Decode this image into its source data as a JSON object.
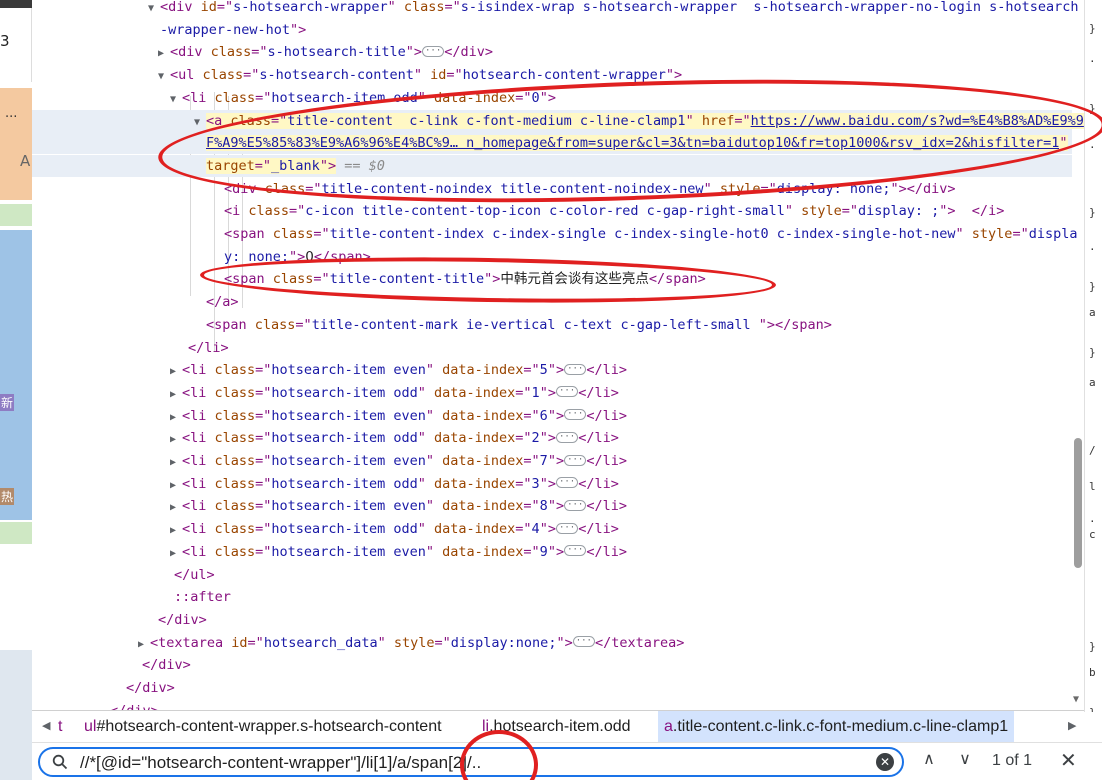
{
  "tree": {
    "rows": [
      {
        "tri": "▼",
        "parts": [
          [
            "tag",
            "<div "
          ],
          [
            "an",
            "id"
          ],
          [
            "tag",
            "=\""
          ],
          [
            "av",
            "s-hotsearch-wrapper"
          ],
          [
            "tag",
            "\" "
          ],
          [
            "an",
            "class"
          ],
          [
            "tag",
            "=\""
          ],
          [
            "av",
            "s-isindex-wrap s-hotsearch-wrapper  s-hotsearch-wrapper-no-login s-hotsearch"
          ]
        ]
      },
      {
        "tri": "",
        "parts": [
          [
            "av",
            "-wrapper-new-hot"
          ],
          [
            "tag",
            "\">"
          ]
        ]
      },
      {
        "tri": "▶",
        "parts": [
          [
            "tag",
            "<div "
          ],
          [
            "an",
            "class"
          ],
          [
            "tag",
            "=\""
          ],
          [
            "av",
            "s-hotsearch-title"
          ],
          [
            "tag",
            "\">"
          ],
          [
            "ell",
            "···"
          ],
          [
            "tag",
            "</div>"
          ]
        ]
      },
      {
        "tri": "▼",
        "parts": [
          [
            "tag",
            "<ul "
          ],
          [
            "an",
            "class"
          ],
          [
            "tag",
            "=\""
          ],
          [
            "av",
            "s-hotsearch-content"
          ],
          [
            "tag",
            "\" "
          ],
          [
            "an",
            "id"
          ],
          [
            "tag",
            "=\""
          ],
          [
            "av",
            "hotsearch-content-wrapper"
          ],
          [
            "tag",
            "\">"
          ]
        ]
      },
      {
        "tri": "▼",
        "parts": [
          [
            "tag",
            "<li "
          ],
          [
            "an",
            "class"
          ],
          [
            "tag",
            "=\""
          ],
          [
            "av",
            "hotsearch-item odd"
          ],
          [
            "tag",
            "\" "
          ],
          [
            "an",
            "data-index"
          ],
          [
            "tag",
            "=\""
          ],
          [
            "av",
            "0"
          ],
          [
            "tag",
            "\">"
          ]
        ]
      },
      {
        "tri": "▼",
        "parts": [
          [
            "tag",
            "<a "
          ],
          [
            "an",
            "class"
          ],
          [
            "tag",
            "=\""
          ],
          [
            "av",
            "title-content  c-link c-font-medium c-line-clamp1"
          ],
          [
            "tag",
            "\" "
          ],
          [
            "an",
            "href"
          ],
          [
            "tag",
            "=\""
          ],
          [
            "avl",
            "https://www.baidu.com/s?wd=%E4%B8%AD%E9%9"
          ]
        ]
      },
      {
        "tri": "",
        "parts": [
          [
            "avl",
            "F%A9%E5%85%83%E9%A6%96%E4%BC%9… n_homepage&from=super&cl=3&tn=baidutop10&fr=top1000&rsv_idx=2&hisfilter=1"
          ],
          [
            "tag",
            "\""
          ]
        ]
      },
      {
        "tri": "",
        "parts": [
          [
            "an",
            "target"
          ],
          [
            "tag",
            "=\""
          ],
          [
            "av",
            "_blank"
          ],
          [
            "tag",
            "\">"
          ],
          [
            "eq",
            " == $0"
          ]
        ]
      },
      {
        "tri": "",
        "parts": [
          [
            "tag",
            "<div "
          ],
          [
            "an",
            "class"
          ],
          [
            "tag",
            "=\""
          ],
          [
            "av",
            "title-content-noindex title-content-noindex-new"
          ],
          [
            "tag",
            "\" "
          ],
          [
            "an",
            "style"
          ],
          [
            "tag",
            "=\""
          ],
          [
            "av",
            "display: none;"
          ],
          [
            "tag",
            "\"></div>"
          ]
        ]
      },
      {
        "tri": "",
        "parts": [
          [
            "tag",
            "<i "
          ],
          [
            "an",
            "class"
          ],
          [
            "tag",
            "=\""
          ],
          [
            "av",
            "c-icon title-content-top-icon c-color-red c-gap-right-small"
          ],
          [
            "tag",
            "\" "
          ],
          [
            "an",
            "style"
          ],
          [
            "tag",
            "=\""
          ],
          [
            "av",
            "display: ;"
          ],
          [
            "tag",
            "\">  </i>"
          ]
        ]
      },
      {
        "tri": "",
        "parts": [
          [
            "tag",
            "<span "
          ],
          [
            "an",
            "class"
          ],
          [
            "tag",
            "=\""
          ],
          [
            "av",
            "title-content-index c-index-single c-index-single-hot0 c-index-single-hot-new"
          ],
          [
            "tag",
            "\" "
          ],
          [
            "an",
            "style"
          ],
          [
            "tag",
            "=\""
          ],
          [
            "av",
            "displa"
          ]
        ]
      },
      {
        "tri": "",
        "parts": [
          [
            "av",
            "y: none;"
          ],
          [
            "tag",
            "\">"
          ],
          [
            "txt",
            "0"
          ],
          [
            "tag",
            "</span>"
          ]
        ]
      },
      {
        "tri": "",
        "parts": [
          [
            "tag",
            "<span "
          ],
          [
            "an",
            "class"
          ],
          [
            "tag",
            "=\""
          ],
          [
            "av",
            "title-content-title"
          ],
          [
            "tag",
            "\">"
          ],
          [
            "txt",
            "中韩元首会谈有这些亮点"
          ],
          [
            "tag",
            "</span>"
          ]
        ]
      },
      {
        "tri": "",
        "parts": [
          [
            "tag",
            "</a>"
          ]
        ]
      },
      {
        "tri": "",
        "parts": [
          [
            "tag",
            "<span "
          ],
          [
            "an",
            "class"
          ],
          [
            "tag",
            "=\""
          ],
          [
            "av",
            "title-content-mark ie-vertical c-text c-gap-left-small "
          ],
          [
            "tag",
            "\"></span>"
          ]
        ]
      },
      {
        "tri": "",
        "parts": [
          [
            "tag",
            "</li>"
          ]
        ]
      },
      {
        "tri": "▶",
        "parts": [
          [
            "tag",
            "<li "
          ],
          [
            "an",
            "class"
          ],
          [
            "tag",
            "=\""
          ],
          [
            "av",
            "hotsearch-item even"
          ],
          [
            "tag",
            "\" "
          ],
          [
            "an",
            "data-index"
          ],
          [
            "tag",
            "=\""
          ],
          [
            "av",
            "5"
          ],
          [
            "tag",
            "\">"
          ],
          [
            "ell",
            "···"
          ],
          [
            "tag",
            "</li>"
          ]
        ]
      },
      {
        "tri": "▶",
        "parts": [
          [
            "tag",
            "<li "
          ],
          [
            "an",
            "class"
          ],
          [
            "tag",
            "=\""
          ],
          [
            "av",
            "hotsearch-item odd"
          ],
          [
            "tag",
            "\" "
          ],
          [
            "an",
            "data-index"
          ],
          [
            "tag",
            "=\""
          ],
          [
            "av",
            "1"
          ],
          [
            "tag",
            "\">"
          ],
          [
            "ell",
            "···"
          ],
          [
            "tag",
            "</li>"
          ]
        ]
      },
      {
        "tri": "▶",
        "parts": [
          [
            "tag",
            "<li "
          ],
          [
            "an",
            "class"
          ],
          [
            "tag",
            "=\""
          ],
          [
            "av",
            "hotsearch-item even"
          ],
          [
            "tag",
            "\" "
          ],
          [
            "an",
            "data-index"
          ],
          [
            "tag",
            "=\""
          ],
          [
            "av",
            "6"
          ],
          [
            "tag",
            "\">"
          ],
          [
            "ell",
            "···"
          ],
          [
            "tag",
            "</li>"
          ]
        ]
      },
      {
        "tri": "▶",
        "parts": [
          [
            "tag",
            "<li "
          ],
          [
            "an",
            "class"
          ],
          [
            "tag",
            "=\""
          ],
          [
            "av",
            "hotsearch-item odd"
          ],
          [
            "tag",
            "\" "
          ],
          [
            "an",
            "data-index"
          ],
          [
            "tag",
            "=\""
          ],
          [
            "av",
            "2"
          ],
          [
            "tag",
            "\">"
          ],
          [
            "ell",
            "···"
          ],
          [
            "tag",
            "</li>"
          ]
        ]
      },
      {
        "tri": "▶",
        "parts": [
          [
            "tag",
            "<li "
          ],
          [
            "an",
            "class"
          ],
          [
            "tag",
            "=\""
          ],
          [
            "av",
            "hotsearch-item even"
          ],
          [
            "tag",
            "\" "
          ],
          [
            "an",
            "data-index"
          ],
          [
            "tag",
            "=\""
          ],
          [
            "av",
            "7"
          ],
          [
            "tag",
            "\">"
          ],
          [
            "ell",
            "···"
          ],
          [
            "tag",
            "</li>"
          ]
        ]
      },
      {
        "tri": "▶",
        "parts": [
          [
            "tag",
            "<li "
          ],
          [
            "an",
            "class"
          ],
          [
            "tag",
            "=\""
          ],
          [
            "av",
            "hotsearch-item odd"
          ],
          [
            "tag",
            "\" "
          ],
          [
            "an",
            "data-index"
          ],
          [
            "tag",
            "=\""
          ],
          [
            "av",
            "3"
          ],
          [
            "tag",
            "\">"
          ],
          [
            "ell",
            "···"
          ],
          [
            "tag",
            "</li>"
          ]
        ]
      },
      {
        "tri": "▶",
        "parts": [
          [
            "tag",
            "<li "
          ],
          [
            "an",
            "class"
          ],
          [
            "tag",
            "=\""
          ],
          [
            "av",
            "hotsearch-item even"
          ],
          [
            "tag",
            "\" "
          ],
          [
            "an",
            "data-index"
          ],
          [
            "tag",
            "=\""
          ],
          [
            "av",
            "8"
          ],
          [
            "tag",
            "\">"
          ],
          [
            "ell",
            "···"
          ],
          [
            "tag",
            "</li>"
          ]
        ]
      },
      {
        "tri": "▶",
        "parts": [
          [
            "tag",
            "<li "
          ],
          [
            "an",
            "class"
          ],
          [
            "tag",
            "=\""
          ],
          [
            "av",
            "hotsearch-item odd"
          ],
          [
            "tag",
            "\" "
          ],
          [
            "an",
            "data-index"
          ],
          [
            "tag",
            "=\""
          ],
          [
            "av",
            "4"
          ],
          [
            "tag",
            "\">"
          ],
          [
            "ell",
            "···"
          ],
          [
            "tag",
            "</li>"
          ]
        ]
      },
      {
        "tri": "▶",
        "parts": [
          [
            "tag",
            "<li "
          ],
          [
            "an",
            "class"
          ],
          [
            "tag",
            "=\""
          ],
          [
            "av",
            "hotsearch-item even"
          ],
          [
            "tag",
            "\" "
          ],
          [
            "an",
            "data-index"
          ],
          [
            "tag",
            "=\""
          ],
          [
            "av",
            "9"
          ],
          [
            "tag",
            "\">"
          ],
          [
            "ell",
            "···"
          ],
          [
            "tag",
            "</li>"
          ]
        ]
      },
      {
        "tri": "",
        "parts": [
          [
            "tag",
            "</ul>"
          ]
        ]
      },
      {
        "tri": "",
        "parts": [
          [
            "pseudo",
            "::after"
          ]
        ]
      },
      {
        "tri": "",
        "parts": [
          [
            "tag",
            "</div>"
          ]
        ]
      },
      {
        "tri": "▶",
        "parts": [
          [
            "tag",
            "<textarea "
          ],
          [
            "an",
            "id"
          ],
          [
            "tag",
            "=\""
          ],
          [
            "av",
            "hotsearch_data"
          ],
          [
            "tag",
            "\" "
          ],
          [
            "an",
            "style"
          ],
          [
            "tag",
            "=\""
          ],
          [
            "av",
            "display:none;"
          ],
          [
            "tag",
            "\">"
          ],
          [
            "ell",
            "···"
          ],
          [
            "tag",
            "</textarea>"
          ]
        ]
      },
      {
        "tri": "",
        "parts": [
          [
            "tag",
            "</div>"
          ]
        ]
      },
      {
        "tri": "",
        "parts": [
          [
            "tag",
            "</div>"
          ]
        ]
      },
      {
        "tri": "",
        "parts": [
          [
            "tag",
            "</div>"
          ]
        ]
      }
    ],
    "dots_label": "···"
  },
  "left_page": {
    "glyphs": [
      "3",
      "A",
      "新",
      "热"
    ]
  },
  "right_styles": {
    "glyphs": [
      "}",
      ".",
      "}",
      ".",
      "}",
      ".",
      "}",
      "a",
      "}",
      "a",
      "/",
      "l",
      ".",
      "c",
      "}",
      "b",
      "}",
      "l"
    ]
  },
  "breadcrumb": {
    "items": [
      {
        "tag": "t",
        "cls": ""
      },
      {
        "tag": "ul",
        "cls": "#hotsearch-content-wrapper.s-hotsearch-content"
      },
      {
        "tag": "li",
        "cls": ".hotsearch-item.odd"
      },
      {
        "tag": "a",
        "cls": ".title-content.c-link.c-font-medium.c-line-clamp1"
      }
    ],
    "left_arrow": "◀",
    "right_arrow": "▶"
  },
  "search": {
    "value": "//*[@id=\"hotsearch-content-wrapper\"]/li[1]/a/span[2]/..",
    "match_count": "1 of 1",
    "prev_icon": "∧",
    "next_icon": "∨",
    "clear_icon": "✕",
    "close_icon": "✕"
  },
  "colors": {
    "annotation": "#e02020",
    "selected_row": "#e8eef6",
    "search_focus": "#1a73e8"
  }
}
